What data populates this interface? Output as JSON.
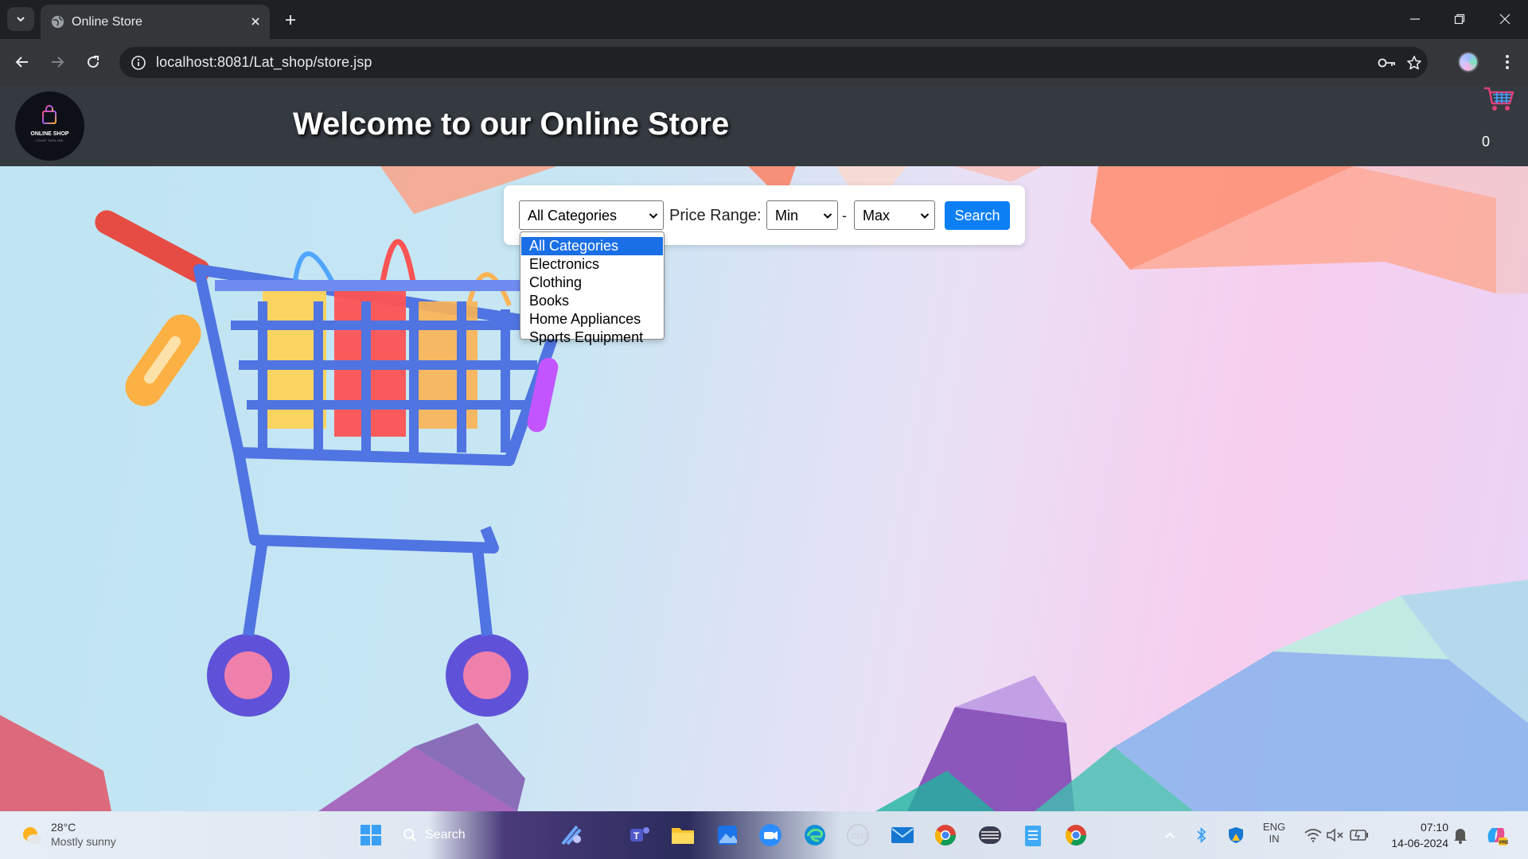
{
  "browser": {
    "tab_title": "Online Store",
    "url": "localhost:8081/Lat_shop/store.jsp"
  },
  "site": {
    "logo_text": "ONLINE SHOP",
    "logo_subtext": "YOUR TAGLINE",
    "welcome": "Welcome to our Online Store",
    "cart_count": "0"
  },
  "search": {
    "category_selected": "All Categories",
    "price_label": "Price Range:",
    "min_selected": "Min",
    "dash": "-",
    "max_selected": "Max",
    "button_label": "Search",
    "category_options": [
      "All Categories",
      "Electronics",
      "Clothing",
      "Books",
      "Home Appliances",
      "Sports Equipment"
    ]
  },
  "taskbar": {
    "weather_temp": "28°C",
    "weather_desc": "Mostly sunny",
    "search_label": "Search",
    "lang_top": "ENG",
    "lang_bottom": "IN",
    "time": "07:10",
    "date": "14-06-2024"
  },
  "colors": {
    "header_bg": "#343a40",
    "search_button": "#0d7ff5",
    "dropdown_highlight": "#1a6fe6"
  }
}
